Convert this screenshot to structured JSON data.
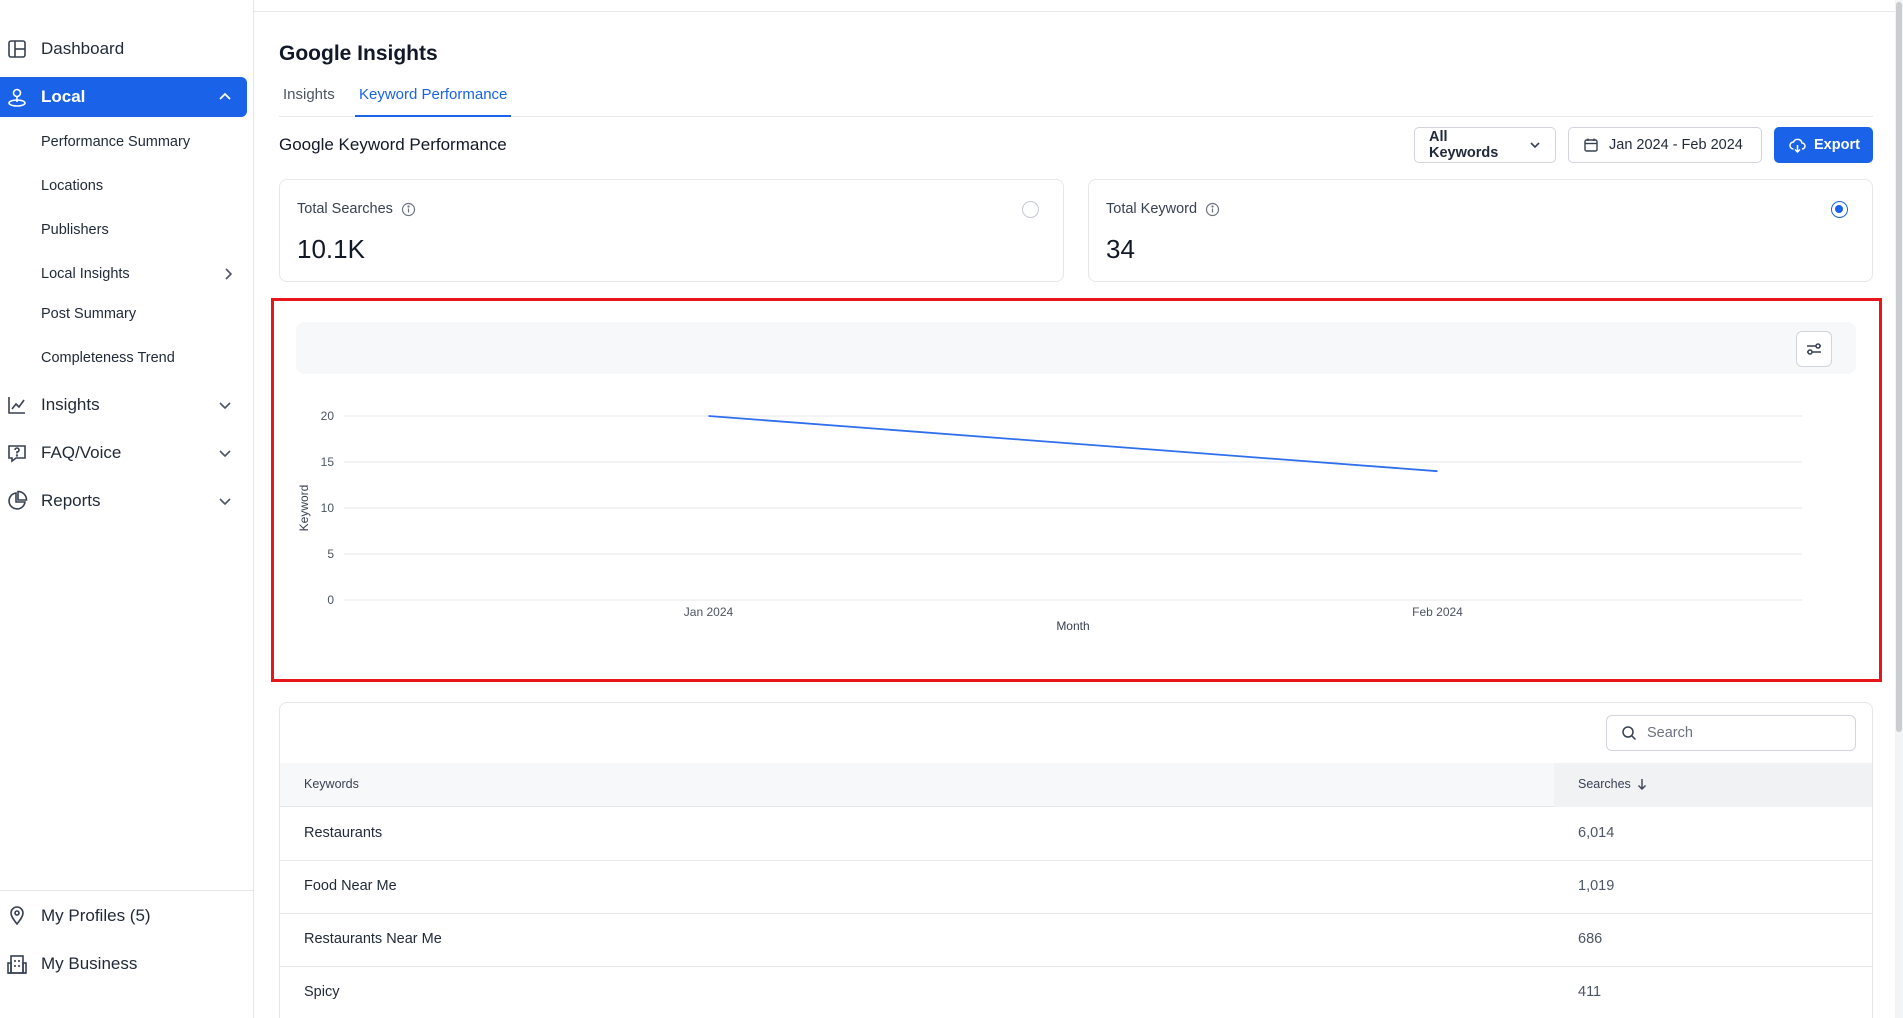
{
  "sidebar": {
    "items": [
      {
        "label": "Dashboard",
        "icon": "dashboard-icon"
      },
      {
        "label": "Local",
        "icon": "local-pin-icon",
        "active": true
      },
      {
        "label": "Insights",
        "icon": "chart-line-icon"
      },
      {
        "label": "FAQ/Voice",
        "icon": "faq-icon"
      },
      {
        "label": "Reports",
        "icon": "pie-chart-icon"
      }
    ],
    "sub_items": [
      "Performance Summary",
      "Locations",
      "Publishers",
      "Local Insights",
      "Post Summary",
      "Completeness Trend"
    ],
    "bottom_items": [
      {
        "label": "My Profiles (5)",
        "icon": "location-pin-icon"
      },
      {
        "label": "My Business",
        "icon": "building-icon"
      }
    ]
  },
  "page": {
    "title": "Google Insights",
    "tabs": [
      {
        "label": "Insights",
        "active": false
      },
      {
        "label": "Keyword Performance",
        "active": true
      }
    ],
    "section_title": "Google Keyword Performance"
  },
  "toolbar": {
    "keyword_filter": "All Keywords",
    "date_range": "Jan 2024 - Feb 2024",
    "export_label": "Export"
  },
  "metrics": [
    {
      "label": "Total Searches",
      "value": "10.1K",
      "selected": false
    },
    {
      "label": "Total Keyword",
      "value": "34",
      "selected": true
    }
  ],
  "chart_data": {
    "type": "line",
    "x": [
      "Jan 2024",
      "Feb 2024"
    ],
    "series": [
      {
        "values": [
          20,
          14
        ],
        "color": "#2f6fed"
      }
    ],
    "xlabel": "Month",
    "ylabel": "Keyword",
    "ylim": [
      0,
      20
    ],
    "yticks": [
      0,
      5,
      10,
      15,
      20
    ],
    "grid": true
  },
  "table": {
    "search_placeholder": "Search",
    "columns": [
      "Keywords",
      "Searches"
    ],
    "rows": [
      {
        "keyword": "Restaurants",
        "searches": "6,014"
      },
      {
        "keyword": "Food Near Me",
        "searches": "1,019"
      },
      {
        "keyword": "Restaurants Near Me",
        "searches": "686"
      },
      {
        "keyword": "Spicy",
        "searches": "411"
      }
    ]
  },
  "colors": {
    "accent": "#1a63e8",
    "highlight": "#e8161b"
  }
}
